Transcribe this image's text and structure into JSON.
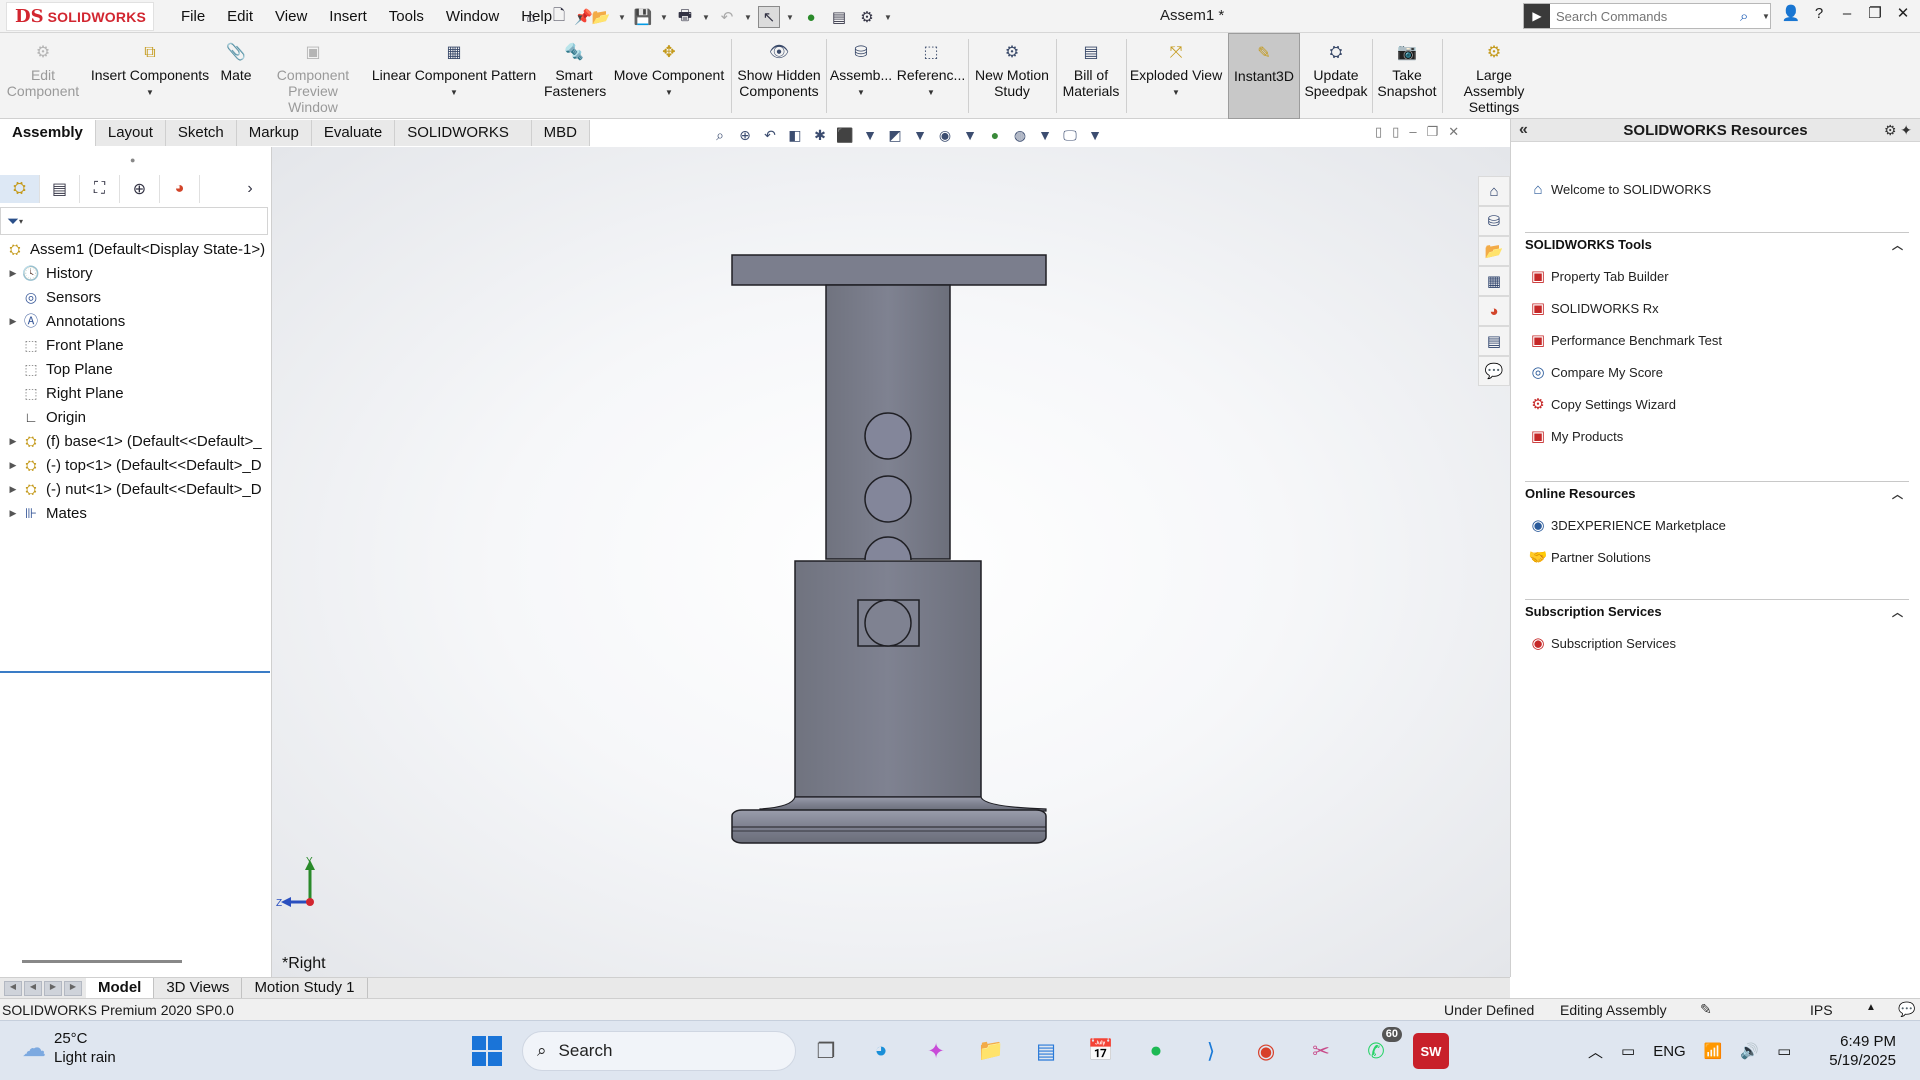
{
  "app": {
    "logo_mark": "DS",
    "logo_text": "SOLIDWORKS",
    "doc_title": "Assem1 *",
    "menus": [
      "File",
      "Edit",
      "View",
      "Insert",
      "Tools",
      "Window",
      "Help"
    ],
    "search_placeholder": "Search Commands"
  },
  "commands": {
    "edit_component": "Edit Component",
    "insert_components": "Insert Components",
    "mate": "Mate",
    "component_preview": "Component Preview Window",
    "linear_pattern": "Linear Component Pattern",
    "smart_fasteners": "Smart Fasteners",
    "move_component": "Move Component",
    "show_hidden": "Show Hidden Components",
    "assembly": "Assemb...",
    "reference": "Referenc...",
    "new_motion": "New Motion Study",
    "bom": "Bill of Materials",
    "exploded_view": "Exploded View",
    "instant3d": "Instant3D",
    "update_speedpak": "Update Speedpak",
    "take_snapshot": "Take Snapshot",
    "large_assembly": "Large Assembly Settings"
  },
  "cmd_tabs": [
    "Assembly",
    "Layout",
    "Sketch",
    "Markup",
    "Evaluate",
    "SOLIDWORKS Add-Ins",
    "MBD"
  ],
  "tree": {
    "root": "Assem1  (Default<Display State-1>)",
    "history": "History",
    "sensors": "Sensors",
    "annotations": "Annotations",
    "front_plane": "Front Plane",
    "top_plane": "Top Plane",
    "right_plane": "Right Plane",
    "origin": "Origin",
    "base": "(f) base<1> (Default<<Default>_",
    "top": "(-) top<1> (Default<<Default>_D",
    "nut": "(-) nut<1> (Default<<Default>_D",
    "mates": "Mates"
  },
  "viewport": {
    "view_name": "*Right",
    "axis_y": "Y",
    "axis_z": "Z"
  },
  "resources": {
    "title": "SOLIDWORKS Resources",
    "welcome": "Welcome to SOLIDWORKS",
    "tools_header": "SOLIDWORKS Tools",
    "tools": [
      "Property Tab Builder",
      "SOLIDWORKS Rx",
      "Performance Benchmark Test",
      "Compare My Score",
      "Copy Settings Wizard",
      "My Products"
    ],
    "online_header": "Online Resources",
    "online": [
      "3DEXPERIENCE Marketplace",
      "Partner Solutions"
    ],
    "subs_header": "Subscription Services",
    "subs": [
      "Subscription Services"
    ]
  },
  "bottom_tabs": [
    "Model",
    "3D Views",
    "Motion Study 1"
  ],
  "status": {
    "product": "SOLIDWORKS Premium 2020 SP0.0",
    "defined": "Under Defined",
    "mode": "Editing Assembly",
    "units": "IPS"
  },
  "taskbar": {
    "temp": "25°C",
    "condition": "Light rain",
    "search": "Search",
    "whatsapp_badge": "60",
    "lang": "ENG",
    "time": "6:49 PM",
    "date": "5/19/2025",
    "sw_label": "SW"
  },
  "colors": {
    "brand_red": "#d22630",
    "model_fill": "#7b7e8d",
    "model_edge": "#1f1f24",
    "tree_accent": "#3a7cc6"
  }
}
